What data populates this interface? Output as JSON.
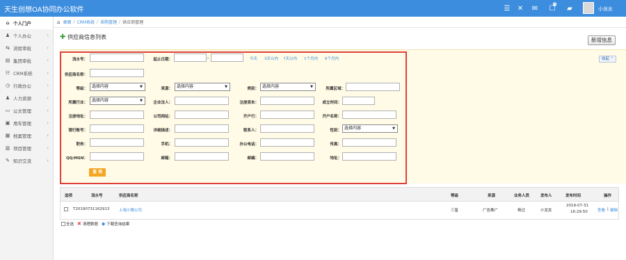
{
  "app": {
    "title": "天生创想OA协同办公软件",
    "username": "小龙女",
    "badges": {
      "chat": "",
      "mail": "0"
    }
  },
  "topbar_icons": [
    "menu-icon",
    "fullscreen-icon",
    "chat-icon",
    "mail-icon",
    "message-icon"
  ],
  "sidebar": {
    "items": [
      {
        "label": "个人门户",
        "icon": "home-icon",
        "glyph": "⌂"
      },
      {
        "label": "个人办公",
        "icon": "user-icon",
        "glyph": "♟"
      },
      {
        "label": "流程审批",
        "icon": "flow-icon",
        "glyph": "⇆"
      },
      {
        "label": "集团审批",
        "icon": "group-icon",
        "glyph": "▤"
      },
      {
        "label": "CRM系统",
        "icon": "crm-icon",
        "glyph": "☷"
      },
      {
        "label": "行政办公",
        "icon": "admin-icon",
        "glyph": "◷"
      },
      {
        "label": "人力资源",
        "icon": "hr-icon",
        "glyph": "♟"
      },
      {
        "label": "公文管理",
        "icon": "document-icon",
        "glyph": "▭"
      },
      {
        "label": "用车管理",
        "icon": "car-icon",
        "glyph": "▣"
      },
      {
        "label": "档案管理",
        "icon": "archive-icon",
        "glyph": "▦"
      },
      {
        "label": "项目管理",
        "icon": "project-icon",
        "glyph": "▥"
      },
      {
        "label": "知识交流",
        "icon": "knowledge-icon",
        "glyph": "✎"
      }
    ]
  },
  "breadcrumb": {
    "items": [
      "桌面",
      "CRM系统",
      "采购管理",
      "供应商管理"
    ]
  },
  "page": {
    "title": "供应商信息列表",
    "new_button": "新增信息"
  },
  "filter": {
    "collapse_label": "收起 ⌃",
    "quick_dates": [
      "今天",
      "3天以内",
      "7天以内",
      "1个月内",
      "6个月内"
    ],
    "date_sep": "-",
    "select_placeholder": "选择内容",
    "labels": {
      "serial": "流水号：",
      "start_date": "起止日期：",
      "supplier_name": "供应商名称：",
      "grade": "等级：",
      "source": "来源：",
      "category": "类别：",
      "region": "所属区域：",
      "industry": "所属行业：",
      "legal": "企业法人：",
      "capital": "注册资本：",
      "founded": "成立时间：",
      "reg_addr": "注册地址：",
      "website": "公司网站：",
      "bank": "开户行：",
      "account_name": "开户名称：",
      "bank_account": "银行账号：",
      "address": "详细描述：",
      "contact": "联系人：",
      "gender": "性别：",
      "position": "职务：",
      "mobile": "手机：",
      "office_phone": "办公电话：",
      "fax": "传真：",
      "qq": "QQ/MSN：",
      "email": "邮箱：",
      "postcode": "邮编：",
      "location": "地址："
    },
    "query_button": "查 询"
  },
  "table": {
    "headers": {
      "select": "选项",
      "serial": "流水号",
      "name": "供应商名称",
      "grade": "等级",
      "source": "来源",
      "staff": "业务人员",
      "publisher": "发布人",
      "publish_time": "发布时间",
      "action": "操作"
    },
    "rows": [
      {
        "serial": "T20190731162913",
        "name": "上海小微公司",
        "grade": "三星",
        "source": "广告推广",
        "staff": "杨过",
        "publisher": "小龙女",
        "date": "2019-07-31",
        "time": "16:29:50",
        "view": "查看",
        "sep": "|",
        "edit": "编辑"
      }
    ]
  },
  "footer": {
    "select_all": "全选",
    "clear": "清理数据",
    "download": "下载查询结果"
  }
}
